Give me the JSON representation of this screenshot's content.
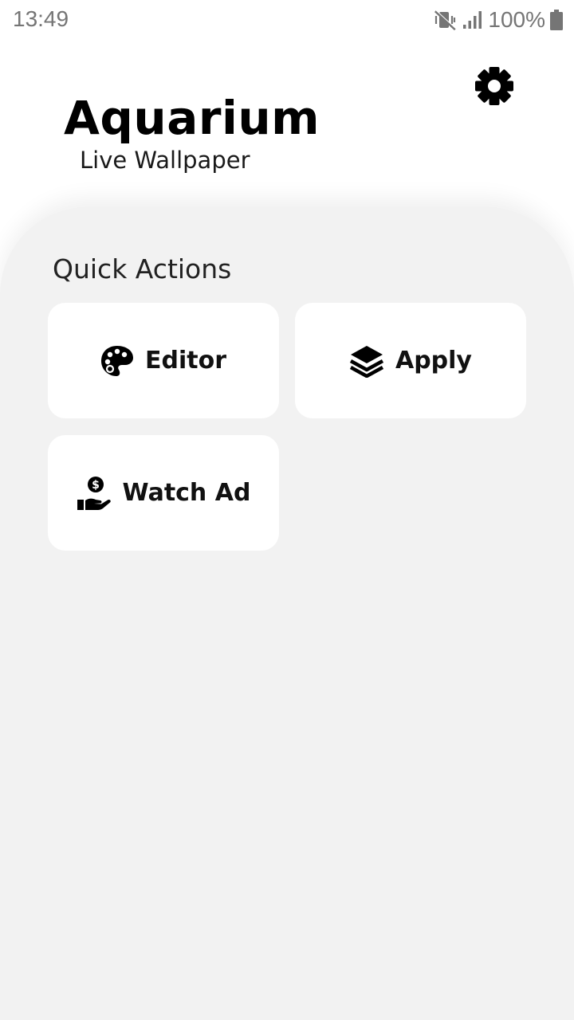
{
  "status_bar": {
    "time": "13:49",
    "battery_text": "100%",
    "icons": [
      "vibrate-mute-icon",
      "signal-icon",
      "battery-icon"
    ]
  },
  "header": {
    "title": "Aquarium",
    "subtitle": "Live Wallpaper",
    "settings_icon": "gear-icon"
  },
  "main": {
    "section_title": "Quick Actions",
    "actions": [
      {
        "label": "Editor",
        "icon": "palette-icon"
      },
      {
        "label": "Apply",
        "icon": "layers-icon"
      },
      {
        "label": "Watch Ad",
        "icon": "hand-coin-icon"
      }
    ]
  },
  "colors": {
    "background": "#ffffff",
    "panel": "#f2f2f2",
    "card": "#ffffff",
    "text": "#111111",
    "status_text": "#757575"
  }
}
